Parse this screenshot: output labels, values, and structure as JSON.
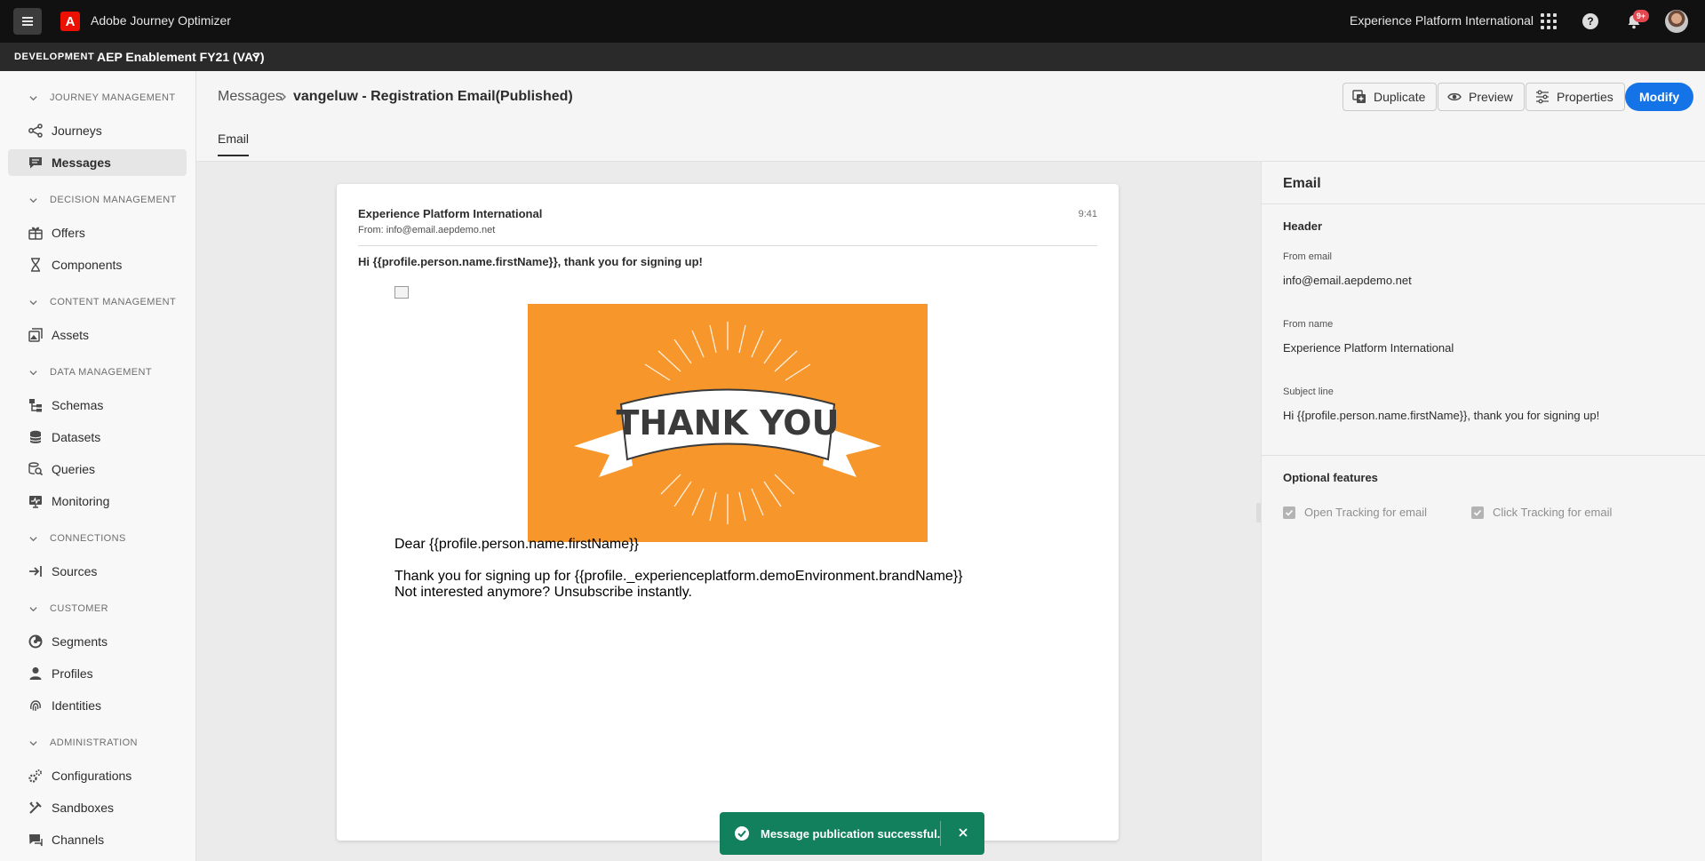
{
  "topbar": {
    "app_title": "Adobe Journey Optimizer",
    "adobe_logo": "A",
    "org_name": "Experience Platform International",
    "help_glyph": "?",
    "notification_badge": "9+"
  },
  "sandbox": {
    "environment": "DEVELOPMENT",
    "name": "AEP Enablement FY21 (VA7)"
  },
  "sidebar": {
    "sections": [
      {
        "label": "JOURNEY MANAGEMENT",
        "items": [
          {
            "label": "Journeys",
            "icon": "journeys-icon"
          },
          {
            "label": "Messages",
            "icon": "messages-icon",
            "active": true
          }
        ]
      },
      {
        "label": "DECISION MANAGEMENT",
        "items": [
          {
            "label": "Offers",
            "icon": "offers-icon"
          },
          {
            "label": "Components",
            "icon": "components-icon"
          }
        ]
      },
      {
        "label": "CONTENT MANAGEMENT",
        "items": [
          {
            "label": "Assets",
            "icon": "assets-icon"
          }
        ]
      },
      {
        "label": "DATA MANAGEMENT",
        "items": [
          {
            "label": "Schemas",
            "icon": "schemas-icon"
          },
          {
            "label": "Datasets",
            "icon": "datasets-icon"
          },
          {
            "label": "Queries",
            "icon": "queries-icon"
          },
          {
            "label": "Monitoring",
            "icon": "monitoring-icon"
          }
        ]
      },
      {
        "label": "CONNECTIONS",
        "items": [
          {
            "label": "Sources",
            "icon": "sources-icon"
          }
        ]
      },
      {
        "label": "CUSTOMER",
        "items": [
          {
            "label": "Segments",
            "icon": "segments-icon"
          },
          {
            "label": "Profiles",
            "icon": "profiles-icon"
          },
          {
            "label": "Identities",
            "icon": "identities-icon"
          }
        ]
      },
      {
        "label": "ADMINISTRATION",
        "items": [
          {
            "label": "Configurations",
            "icon": "configurations-icon"
          },
          {
            "label": "Sandboxes",
            "icon": "sandboxes-icon"
          },
          {
            "label": "Channels",
            "icon": "channels-icon"
          }
        ]
      }
    ]
  },
  "header": {
    "breadcrumb_root": "Messages",
    "breadcrumb_current": "vangeluw - Registration Email(Published)",
    "tab": "Email",
    "buttons": {
      "duplicate": "Duplicate",
      "preview": "Preview",
      "properties": "Properties",
      "modify": "Modify"
    }
  },
  "email_preview": {
    "sender_name": "Experience Platform International",
    "from_prefix": "From:",
    "from_address": "info@email.aepdemo.net",
    "time": "9:41",
    "subject": "Hi {{profile.person.name.firstName}}, thank you for signing up!",
    "banner_text": "THANK YOU",
    "greeting": "Dear {{profile.person.name.firstName}}",
    "body_line1": "Thank you for signing up for {{profile._experienceplatform.demoEnvironment.brandName}}",
    "body_line2": "Not interested anymore? Unsubscribe instantly.",
    "banner_color": "#f7962a"
  },
  "properties_panel": {
    "title": "Email",
    "header_section": "Header",
    "from_email_label": "From email",
    "from_email_value": "info@email.aepdemo.net",
    "from_name_label": "From name",
    "from_name_value": "Experience Platform International",
    "subject_label": "Subject line",
    "subject_value": "Hi {{profile.person.name.firstName}}, thank you for signing up!",
    "optional_section": "Optional features",
    "open_tracking": "Open Tracking for email",
    "click_tracking": "Click Tracking for email",
    "open_tracking_checked": true,
    "click_tracking_checked": true
  },
  "toast": {
    "message": "Message publication successful.",
    "color": "#12805c"
  },
  "colors": {
    "accent": "#1473e6",
    "adobe_red": "#eb1000"
  }
}
